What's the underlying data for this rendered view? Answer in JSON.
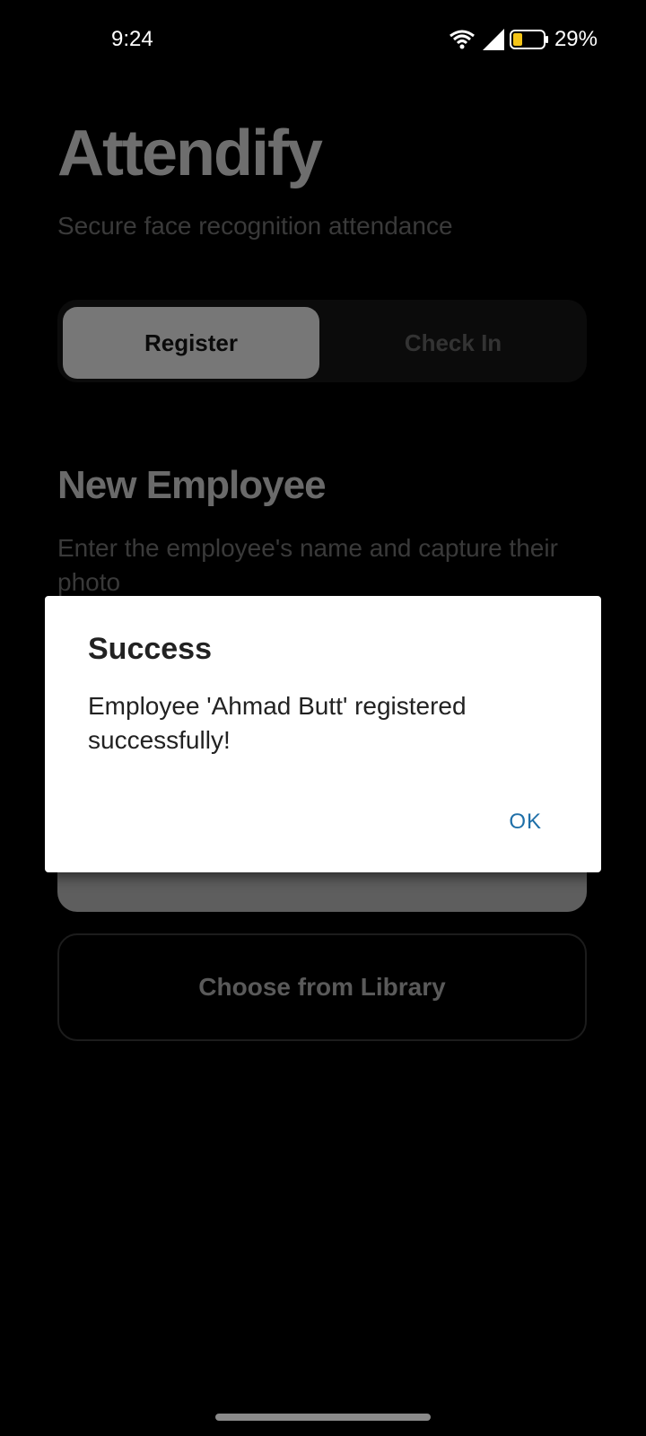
{
  "status_bar": {
    "time": "9:24",
    "battery": "29%",
    "icons": [
      "wifi-icon",
      "signal-icon",
      "battery-icon"
    ]
  },
  "app": {
    "title": "Attendify",
    "subtitle": "Secure face recognition attendance",
    "tabs": [
      {
        "label": "Register",
        "selected": true
      },
      {
        "label": "Check In",
        "selected": false
      }
    ],
    "section": {
      "title": "New Employee",
      "description": "Enter the employee's name and capture their photo"
    },
    "library_button": "Choose from Library"
  },
  "dialog": {
    "title": "Success",
    "message": "Employee 'Ahmad Butt' registered successfully!",
    "ok_label": "OK"
  },
  "colors": {
    "accent": "#1e6fa8",
    "background": "#000000",
    "dialog_bg": "#ffffff"
  }
}
